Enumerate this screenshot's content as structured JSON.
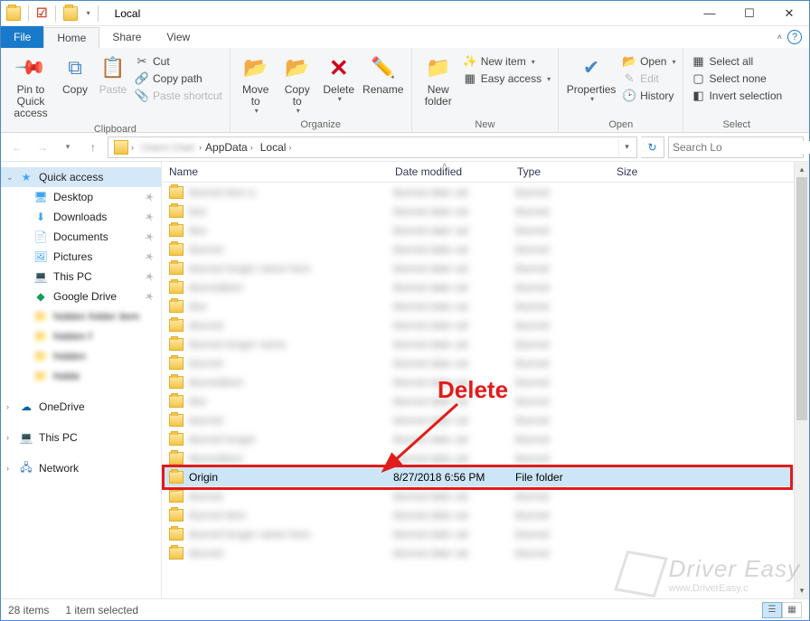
{
  "title": "Local",
  "tabs": {
    "file": "File",
    "home": "Home",
    "share": "Share",
    "view": "View"
  },
  "ribbon": {
    "clipboard": {
      "label": "Clipboard",
      "pin": "Pin to Quick\naccess",
      "copy": "Copy",
      "paste": "Paste",
      "cut": "Cut",
      "copy_path": "Copy path",
      "paste_shortcut": "Paste shortcut"
    },
    "organize": {
      "label": "Organize",
      "move_to": "Move\nto",
      "copy_to": "Copy\nto",
      "delete": "Delete",
      "rename": "Rename"
    },
    "new": {
      "label": "New",
      "new_folder": "New\nfolder",
      "new_item": "New item",
      "easy_access": "Easy access"
    },
    "open": {
      "label": "Open",
      "properties": "Properties",
      "open": "Open",
      "edit": "Edit",
      "history": "History"
    },
    "select": {
      "label": "Select",
      "select_all": "Select all",
      "select_none": "Select none",
      "invert": "Invert selection"
    }
  },
  "breadcrumb": {
    "hidden": "Users User",
    "app": "AppData",
    "local": "Local"
  },
  "search_placeholder": "Search Lo",
  "columns": {
    "name": "Name",
    "date": "Date modified",
    "type": "Type",
    "size": "Size"
  },
  "nav": {
    "quick": "Quick access",
    "desktop": "Desktop",
    "downloads": "Downloads",
    "documents": "Documents",
    "pictures": "Pictures",
    "thispc": "This PC",
    "gdrive": "Google Drive",
    "onedrive": "OneDrive",
    "thispc2": "This PC",
    "network": "Network"
  },
  "selected_row": {
    "name": "Origin",
    "date": "8/27/2018 6:56 PM",
    "type": "File folder"
  },
  "blurred_rows": [
    "blurred item a",
    "blur",
    "blur",
    "blurred",
    "blurred longer name here",
    "blurreditem",
    "blur",
    "blurred",
    "blurred longer name",
    "blurred",
    "blurreditem",
    "blur",
    "blurred",
    "blurred longer",
    "blurreditem"
  ],
  "blurred_rows_after": [
    "blurred",
    "blurred item",
    "blurred longer name here",
    "blurred"
  ],
  "status": {
    "count": "28 items",
    "selected": "1 item selected"
  },
  "annotation": "Delete",
  "watermark": {
    "line1": "Driver Easy",
    "line2": "www.DriverEasy.c"
  }
}
